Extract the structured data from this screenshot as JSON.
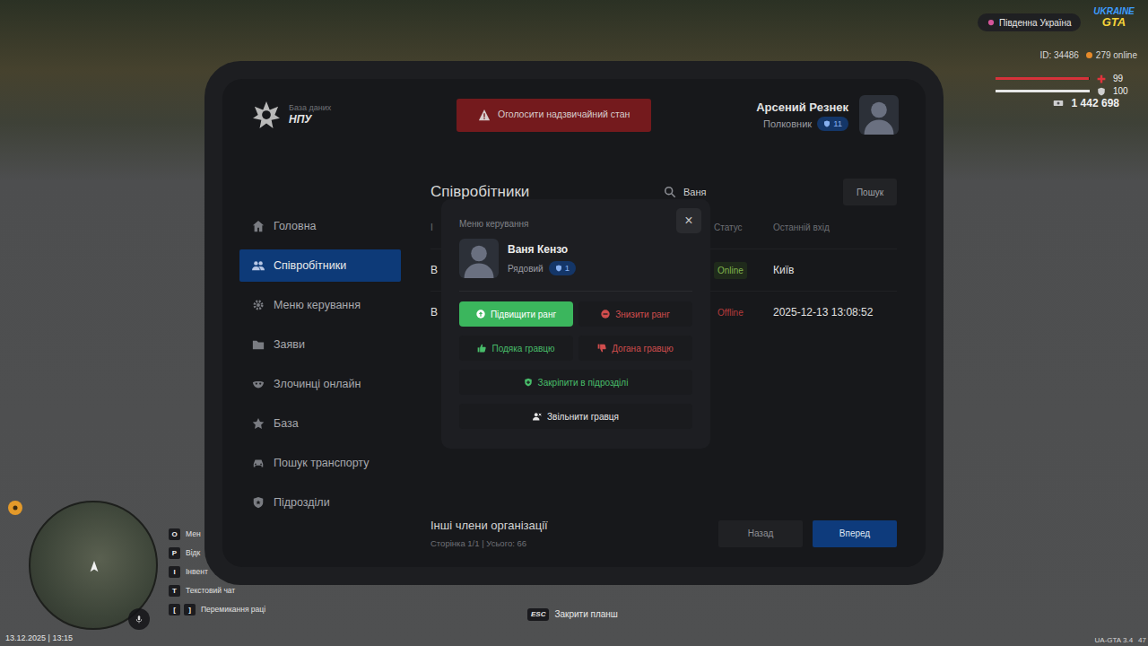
{
  "hud": {
    "region": "Південна Україна",
    "logo": {
      "top": "UKRAINE",
      "bottom": "GTA"
    },
    "player_id": "ID: 34486",
    "online": "279 online",
    "health": {
      "value": "99",
      "level": 0.99
    },
    "armor": {
      "value": "100",
      "level": 1
    },
    "money": "1 442 698",
    "keybinds": [
      {
        "keys": [
          "O"
        ],
        "label": "Мен"
      },
      {
        "keys": [
          "P"
        ],
        "label": "Відк"
      },
      {
        "keys": [
          "I"
        ],
        "label": "Інвент"
      },
      {
        "keys": [
          "T"
        ],
        "label": "Текстовий чат"
      },
      {
        "keys": [
          "[",
          "]"
        ],
        "label": "Перемикання раці"
      }
    ],
    "datetime": "13.12.2025 | 13:15",
    "close_hint": {
      "key": "ESC",
      "label": "Закрити планш"
    },
    "version": "UA-GTA 3.4",
    "fps": "47"
  },
  "tablet": {
    "brand": {
      "subtitle": "База даних",
      "title": "НПУ"
    },
    "emergency_button": "Оголосити надзвичайний стан",
    "user": {
      "name": "Арсений Резнек",
      "rank": "Полковник",
      "rank_level": "11"
    },
    "sidebar": {
      "items": [
        {
          "label": "Головна",
          "selected": false
        },
        {
          "label": "Співробітники",
          "selected": true
        },
        {
          "label": "Меню керування",
          "selected": false
        },
        {
          "label": "Заяви",
          "selected": false
        },
        {
          "label": "Злочинці онлайн",
          "selected": false
        },
        {
          "label": "База",
          "selected": false
        },
        {
          "label": "Пошук транспорту",
          "selected": false
        },
        {
          "label": "Підрозділи",
          "selected": false
        }
      ]
    },
    "employees": {
      "title": "Співробітники",
      "search": {
        "value": "Ваня"
      },
      "search_button": "Пошук",
      "columns": [
        "І",
        "Статус",
        "Останній вхід"
      ],
      "rows": [
        {
          "name": "В",
          "status": "Online",
          "online": true,
          "last_seen": "Київ"
        },
        {
          "name": "В",
          "status": "Offline",
          "online": false,
          "last_seen": "2025-12-13 13:08:52"
        }
      ]
    },
    "footer": {
      "title": "Інші члени організації",
      "pagination": "Сторінка 1/1 | Усього: 66",
      "prev": "Назад",
      "next": "Вперед"
    }
  },
  "modal": {
    "title": "Меню керування",
    "close": "×",
    "member": {
      "name": "Ваня Кензо",
      "rank": "Рядовий",
      "rank_level": "1"
    },
    "action_rows": [
      [
        {
          "label": "Підвищити ранг",
          "kind": "positive",
          "hovered": true
        },
        {
          "label": "Знизити ранг",
          "kind": "negative",
          "hovered": false
        }
      ],
      [
        {
          "label": "Подяка гравцю",
          "kind": "positive",
          "hovered": false
        },
        {
          "label": "Догана гравцю",
          "kind": "negative",
          "hovered": false
        }
      ],
      [
        {
          "label": "Закріпити в підрозділі",
          "kind": "positive",
          "hovered": false
        }
      ],
      [
        {
          "label": "Звільнити гравця",
          "kind": "neutral",
          "hovered": false
        }
      ]
    ]
  }
}
